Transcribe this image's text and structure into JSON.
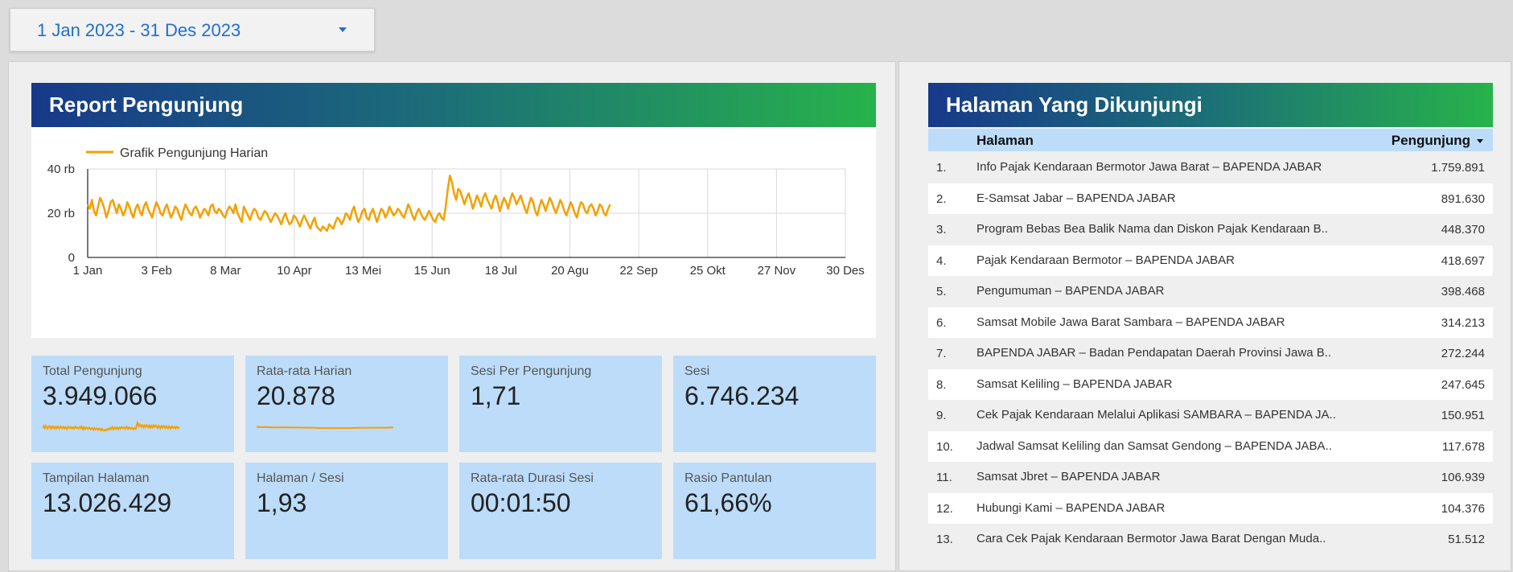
{
  "date_range": {
    "label": "1 Jan 2023 - 31 Des 2023"
  },
  "report": {
    "title": "Report Pengunjung",
    "chart_data": {
      "type": "line",
      "title": "",
      "legend": "Grafik Pengunjung Harian",
      "legend_position": "top-left",
      "series_color": "#f5a000",
      "x_start_date": "2023-01-01",
      "x_ticks": [
        "1 Jan",
        "3 Feb",
        "8 Mar",
        "10 Apr",
        "13 Mei",
        "15 Jun",
        "18 Jul",
        "20 Agu",
        "22 Sep",
        "25 Okt",
        "27 Nov",
        "30 Des"
      ],
      "y_ticks": [
        "0",
        "20 rb",
        "40 rb"
      ],
      "ylim": [
        0,
        40000
      ],
      "grid": true,
      "daily_values": [
        24000,
        22000,
        26000,
        21000,
        19000,
        23000,
        27000,
        25000,
        22000,
        18000,
        21000,
        25000,
        26000,
        23000,
        20000,
        24000,
        22000,
        19000,
        21000,
        25000,
        23000,
        20000,
        18000,
        22000,
        24000,
        21000,
        19000,
        23000,
        25000,
        22000,
        20000,
        18000,
        22000,
        25000,
        23000,
        20000,
        19000,
        22000,
        24000,
        21000,
        18000,
        20000,
        23000,
        22000,
        19000,
        17000,
        21000,
        24000,
        22000,
        20000,
        19000,
        22000,
        23000,
        21000,
        18000,
        20000,
        22000,
        21000,
        19000,
        23000,
        24000,
        21000,
        20000,
        22000,
        21000,
        19000,
        18000,
        21000,
        23000,
        22000,
        20000,
        24000,
        20000,
        18000,
        16000,
        23000,
        21000,
        19000,
        17000,
        20000,
        22000,
        21000,
        18000,
        17000,
        19000,
        21000,
        20000,
        18000,
        16000,
        18000,
        20000,
        19000,
        17000,
        15000,
        18000,
        20000,
        17000,
        15000,
        16000,
        19000,
        18000,
        16000,
        14000,
        17000,
        19000,
        17000,
        15000,
        13000,
        16000,
        18000,
        14000,
        13000,
        12000,
        14000,
        13000,
        12000,
        15000,
        14000,
        13000,
        16000,
        18000,
        17000,
        15000,
        17000,
        20000,
        19000,
        17000,
        21000,
        23000,
        19000,
        16000,
        18000,
        21000,
        22000,
        18000,
        17000,
        20000,
        22000,
        19000,
        16000,
        19000,
        22000,
        21000,
        18000,
        20000,
        23000,
        21000,
        19000,
        20000,
        22000,
        21000,
        19000,
        18000,
        21000,
        24000,
        22000,
        19000,
        17000,
        20000,
        22000,
        20000,
        18000,
        17000,
        19000,
        21000,
        19000,
        17000,
        16000,
        19000,
        20000,
        18000,
        17000,
        23000,
        31000,
        37000,
        34000,
        29000,
        26000,
        31000,
        30000,
        27000,
        24000,
        27000,
        29000,
        26000,
        22000,
        25000,
        28000,
        26000,
        23000,
        27000,
        29000,
        26000,
        24000,
        22000,
        26000,
        28000,
        25000,
        21000,
        24000,
        27000,
        25000,
        22000,
        26000,
        29000,
        27000,
        24000,
        26000,
        28000,
        25000,
        22000,
        20000,
        24000,
        27000,
        25000,
        21000,
        19000,
        23000,
        26000,
        24000,
        21000,
        24000,
        27000,
        25000,
        22000,
        20000,
        23000,
        26000,
        24000,
        21000,
        19000,
        22000,
        25000,
        23000,
        20000,
        18000,
        22000,
        25000,
        24000,
        21000,
        20000,
        23000,
        24000,
        22000,
        19000,
        21000,
        24000,
        23000,
        20000,
        19000,
        22000,
        24000
      ]
    }
  },
  "cards": [
    {
      "label": "Total Pengunjung",
      "value": "3.949.066"
    },
    {
      "label": "Rata-rata Harian",
      "value": "20.878"
    },
    {
      "label": "Sesi Per Pengunjung",
      "value": "1,71"
    },
    {
      "label": "Sesi",
      "value": "6.746.234"
    },
    {
      "label": "Tampilan Halaman",
      "value": "13.026.429"
    },
    {
      "label": "Halaman / Sesi",
      "value": "1,93"
    },
    {
      "label": "Rata-rata Durasi Sesi",
      "value": "00:01:50"
    },
    {
      "label": "Rasio Pantulan",
      "value": "61,66%"
    }
  ],
  "pages_table": {
    "title": "Halaman Yang Dikunjungi",
    "col_page": "Halaman",
    "col_visitors": "Pengunjung",
    "rows": [
      {
        "no": "1.",
        "page": "Info Pajak Kendaraan Bermotor Jawa Barat – BAPENDA JABAR",
        "visitors": "1.759.891"
      },
      {
        "no": "2.",
        "page": "E-Samsat Jabar – BAPENDA JABAR",
        "visitors": "891.630"
      },
      {
        "no": "3.",
        "page": "Program Bebas Bea Balik Nama dan Diskon Pajak Kendaraan B..",
        "visitors": "448.370"
      },
      {
        "no": "4.",
        "page": "Pajak Kendaraan Bermotor – BAPENDA JABAR",
        "visitors": "418.697"
      },
      {
        "no": "5.",
        "page": "Pengumuman – BAPENDA JABAR",
        "visitors": "398.468"
      },
      {
        "no": "6.",
        "page": "Samsat Mobile Jawa Barat Sambara – BAPENDA JABAR",
        "visitors": "314.213"
      },
      {
        "no": "7.",
        "page": "BAPENDA JABAR – Badan Pendapatan Daerah Provinsi Jawa B..",
        "visitors": "272.244"
      },
      {
        "no": "8.",
        "page": "Samsat Keliling – BAPENDA JABAR",
        "visitors": "247.645"
      },
      {
        "no": "9.",
        "page": "Cek Pajak Kendaraan Melalui Aplikasi SAMBARA – BAPENDA JA..",
        "visitors": "150.951"
      },
      {
        "no": "10.",
        "page": "Jadwal Samsat Keliling dan Samsat Gendong – BAPENDA JABA..",
        "visitors": "117.678"
      },
      {
        "no": "11.",
        "page": "Samsat Jbret – BAPENDA JABAR",
        "visitors": "106.939"
      },
      {
        "no": "12.",
        "page": "Hubungi Kami – BAPENDA JABAR",
        "visitors": "104.376"
      },
      {
        "no": "13.",
        "page": "Cara Cek Pajak Kendaraan Bermotor Jawa Barat Dengan Muda..",
        "visitors": "51.512"
      }
    ]
  }
}
